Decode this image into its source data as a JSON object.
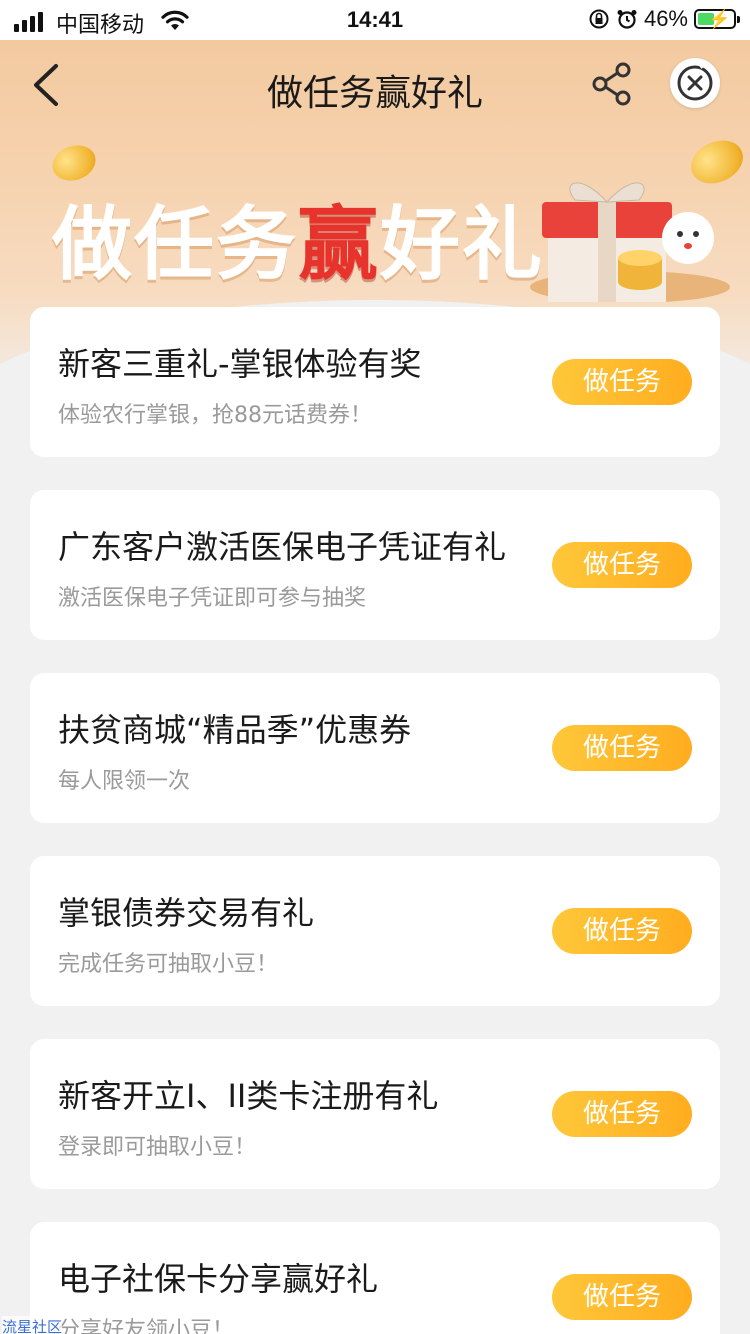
{
  "status_bar": {
    "carrier": "中国移动",
    "time": "14:41",
    "battery_percent": "46%",
    "battery_level": 0.46
  },
  "nav": {
    "title": "做任务赢好礼",
    "back_icon": "chevron-left-icon",
    "share_icon": "share-icon",
    "close_icon": "close-circle-icon"
  },
  "banner": {
    "title_part1": "做任务",
    "title_highlight": "赢",
    "title_part2": "好礼"
  },
  "tasks": [
    {
      "title": "新客三重礼-掌银体验有奖",
      "subtitle": "体验农行掌银，抢88元话费券！",
      "button": "做任务"
    },
    {
      "title": "广东客户激活医保电子凭证有礼",
      "subtitle": "激活医保电子凭证即可参与抽奖",
      "button": "做任务"
    },
    {
      "title": "扶贫商城“精品季”优惠券",
      "subtitle": "每人限领一次",
      "button": "做任务"
    },
    {
      "title": "掌银债券交易有礼",
      "subtitle": "完成任务可抽取小豆！",
      "button": "做任务"
    },
    {
      "title": "新客开立I、II类卡注册有礼",
      "subtitle": "登录即可抽取小豆！",
      "button": "做任务"
    },
    {
      "title": "电子社保卡分享赢好礼",
      "subtitle": "分享好友领小豆！",
      "button": "做任务"
    }
  ],
  "watermark": "流星社区",
  "colors": {
    "button": "#ffb52a",
    "banner_highlight": "#e8332c",
    "header_bg": "#f2c79b"
  }
}
